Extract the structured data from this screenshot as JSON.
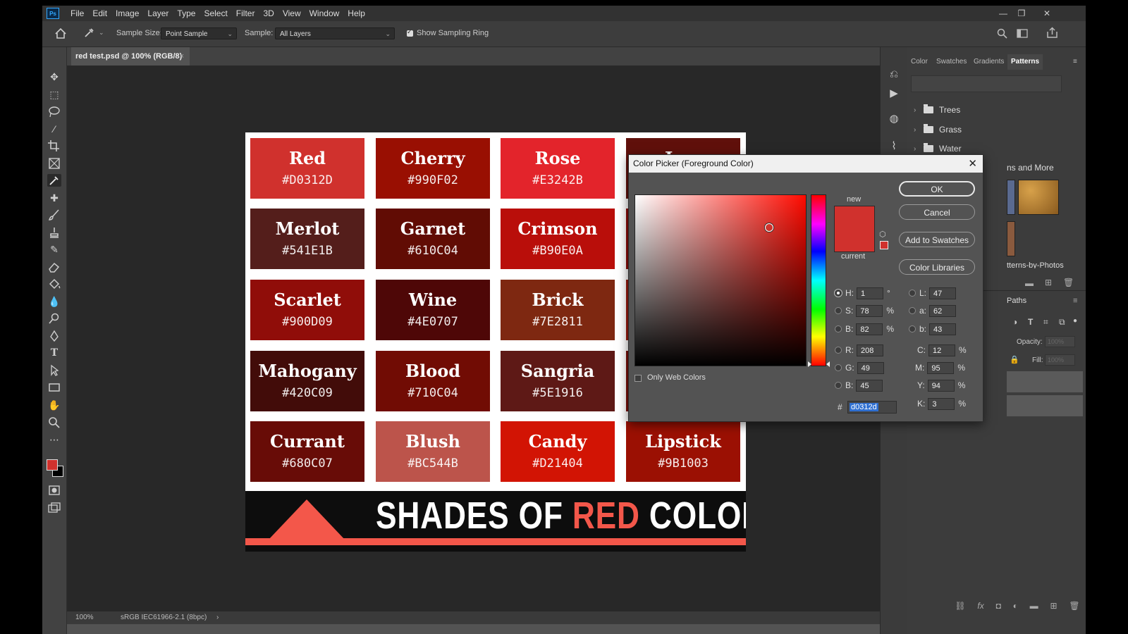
{
  "menu": [
    "File",
    "Edit",
    "Image",
    "Layer",
    "Type",
    "Select",
    "Filter",
    "3D",
    "View",
    "Window",
    "Help"
  ],
  "app_logo": "Ps",
  "window_controls": {
    "minimize": "—",
    "restore": "❐",
    "close": "✕"
  },
  "options_bar": {
    "sample_size_label": "Sample Size:",
    "sample_size_value": "Point Sample",
    "sample_label": "Sample:",
    "sample_value": "All Layers",
    "show_sampling_ring_label": "Show Sampling Ring",
    "show_sampling_ring_checked": true
  },
  "document": {
    "tab_title": "red test.psd @ 100% (RGB/8)",
    "tab_close": "×",
    "zoom": "100%",
    "color_profile": "sRGB IEC61966-2.1 (8bpc)",
    "status_arrow": "›"
  },
  "artwork": {
    "swatches": [
      {
        "name": "Red",
        "hex": "#D0312D",
        "color": "#d0312d"
      },
      {
        "name": "Cherry",
        "hex": "#990F02",
        "color": "#990f02"
      },
      {
        "name": "Rose",
        "hex": "#E3242B",
        "color": "#e3242b"
      },
      {
        "name": "Jam",
        "hex": "",
        "color": "#60100b"
      },
      {
        "name": "Merlot",
        "hex": "#541E1B",
        "color": "#541e1b"
      },
      {
        "name": "Garnet",
        "hex": "#610C04",
        "color": "#610c04"
      },
      {
        "name": "Crimson",
        "hex": "#B90E0A",
        "color": "#b90e0a"
      },
      {
        "name": "",
        "hex": "",
        "color": "#8d0c0a"
      },
      {
        "name": "Scarlet",
        "hex": "#900D09",
        "color": "#900d09"
      },
      {
        "name": "Wine",
        "hex": "#4E0707",
        "color": "#4e0707"
      },
      {
        "name": "Brick",
        "hex": "#7E2811",
        "color": "#7e2811"
      },
      {
        "name": "",
        "hex": "",
        "color": "#9a1a0e"
      },
      {
        "name": "Mahogany",
        "hex": "#420C09",
        "color": "#420c09"
      },
      {
        "name": "Blood",
        "hex": "#710C04",
        "color": "#710c04"
      },
      {
        "name": "Sangria",
        "hex": "#5E1916",
        "color": "#5e1916"
      },
      {
        "name": "",
        "hex": "",
        "color": "#7a0f0a"
      },
      {
        "name": "Currant",
        "hex": "#680C07",
        "color": "#680c07"
      },
      {
        "name": "Blush",
        "hex": "#BC544B",
        "color": "#bc544b"
      },
      {
        "name": "Candy",
        "hex": "#D21404",
        "color": "#d21404"
      },
      {
        "name": "Lipstick",
        "hex": "#9B1003",
        "color": "#9b1003"
      }
    ],
    "banner": {
      "part1": "SHADES OF ",
      "accent": "RED",
      "part2": " COLOR"
    }
  },
  "panels": {
    "tabs": [
      "Color",
      "Swatches",
      "Gradients",
      "Patterns"
    ],
    "active_tab": "Patterns",
    "folders": [
      "Trees",
      "Grass",
      "Water"
    ],
    "more_label": "ns and More",
    "photos_label": "tterns-by-Photos",
    "paths_tab": "Paths",
    "opacity_label": "Opacity:",
    "opacity_value": "100%",
    "fill_label": "Fill:",
    "fill_value": "100%"
  },
  "color_picker": {
    "title": "Color Picker (Foreground Color)",
    "close": "✕",
    "new_label": "new",
    "current_label": "current",
    "new_color": "#d0312d",
    "current_color": "#d0312d",
    "buttons": {
      "ok": "OK",
      "cancel": "Cancel",
      "add_to_swatches": "Add to Swatches",
      "color_libraries": "Color Libraries"
    },
    "only_web_colors": "Only Web Colors",
    "fields": {
      "H": "1",
      "S": "78",
      "B": "82",
      "R": "208",
      "G": "49",
      "B2": "45",
      "L": "47",
      "a": "62",
      "b": "43",
      "C": "12",
      "M": "95",
      "Y": "94",
      "K": "3"
    },
    "units": {
      "deg": "°",
      "pct": "%"
    },
    "hex_label": "#",
    "hex": "d0312d"
  }
}
